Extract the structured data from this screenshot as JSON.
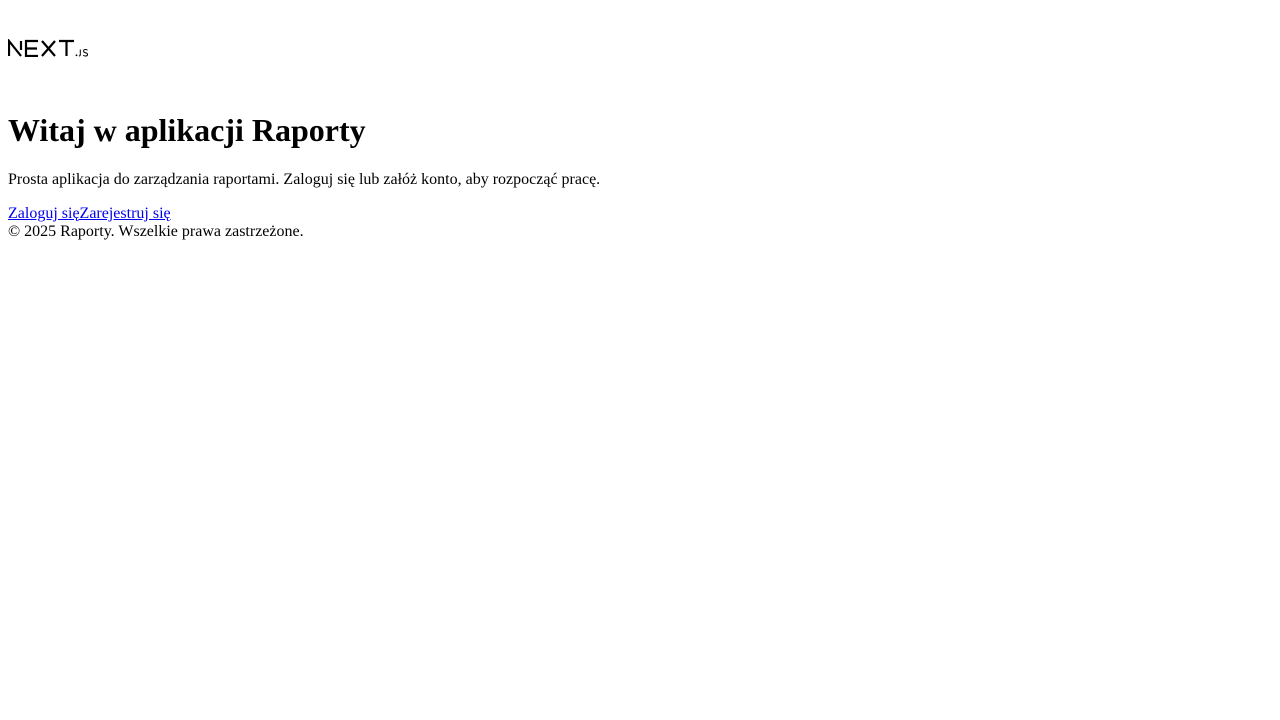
{
  "header": {
    "logo_icon": "nextjs-logo-icon"
  },
  "main": {
    "title": "Witaj w aplikacji Raporty",
    "subtitle": "Prosta aplikacja do zarządzania raportami. Zaloguj się lub załóż konto, aby rozpocząć pracę."
  },
  "links": {
    "login_label": "Zaloguj się",
    "register_label": "Zarejestruj się",
    "link_color": "#0000ee"
  },
  "footer": {
    "copyright": "© 2025 Raporty. Wszelkie prawa zastrzeżone."
  }
}
